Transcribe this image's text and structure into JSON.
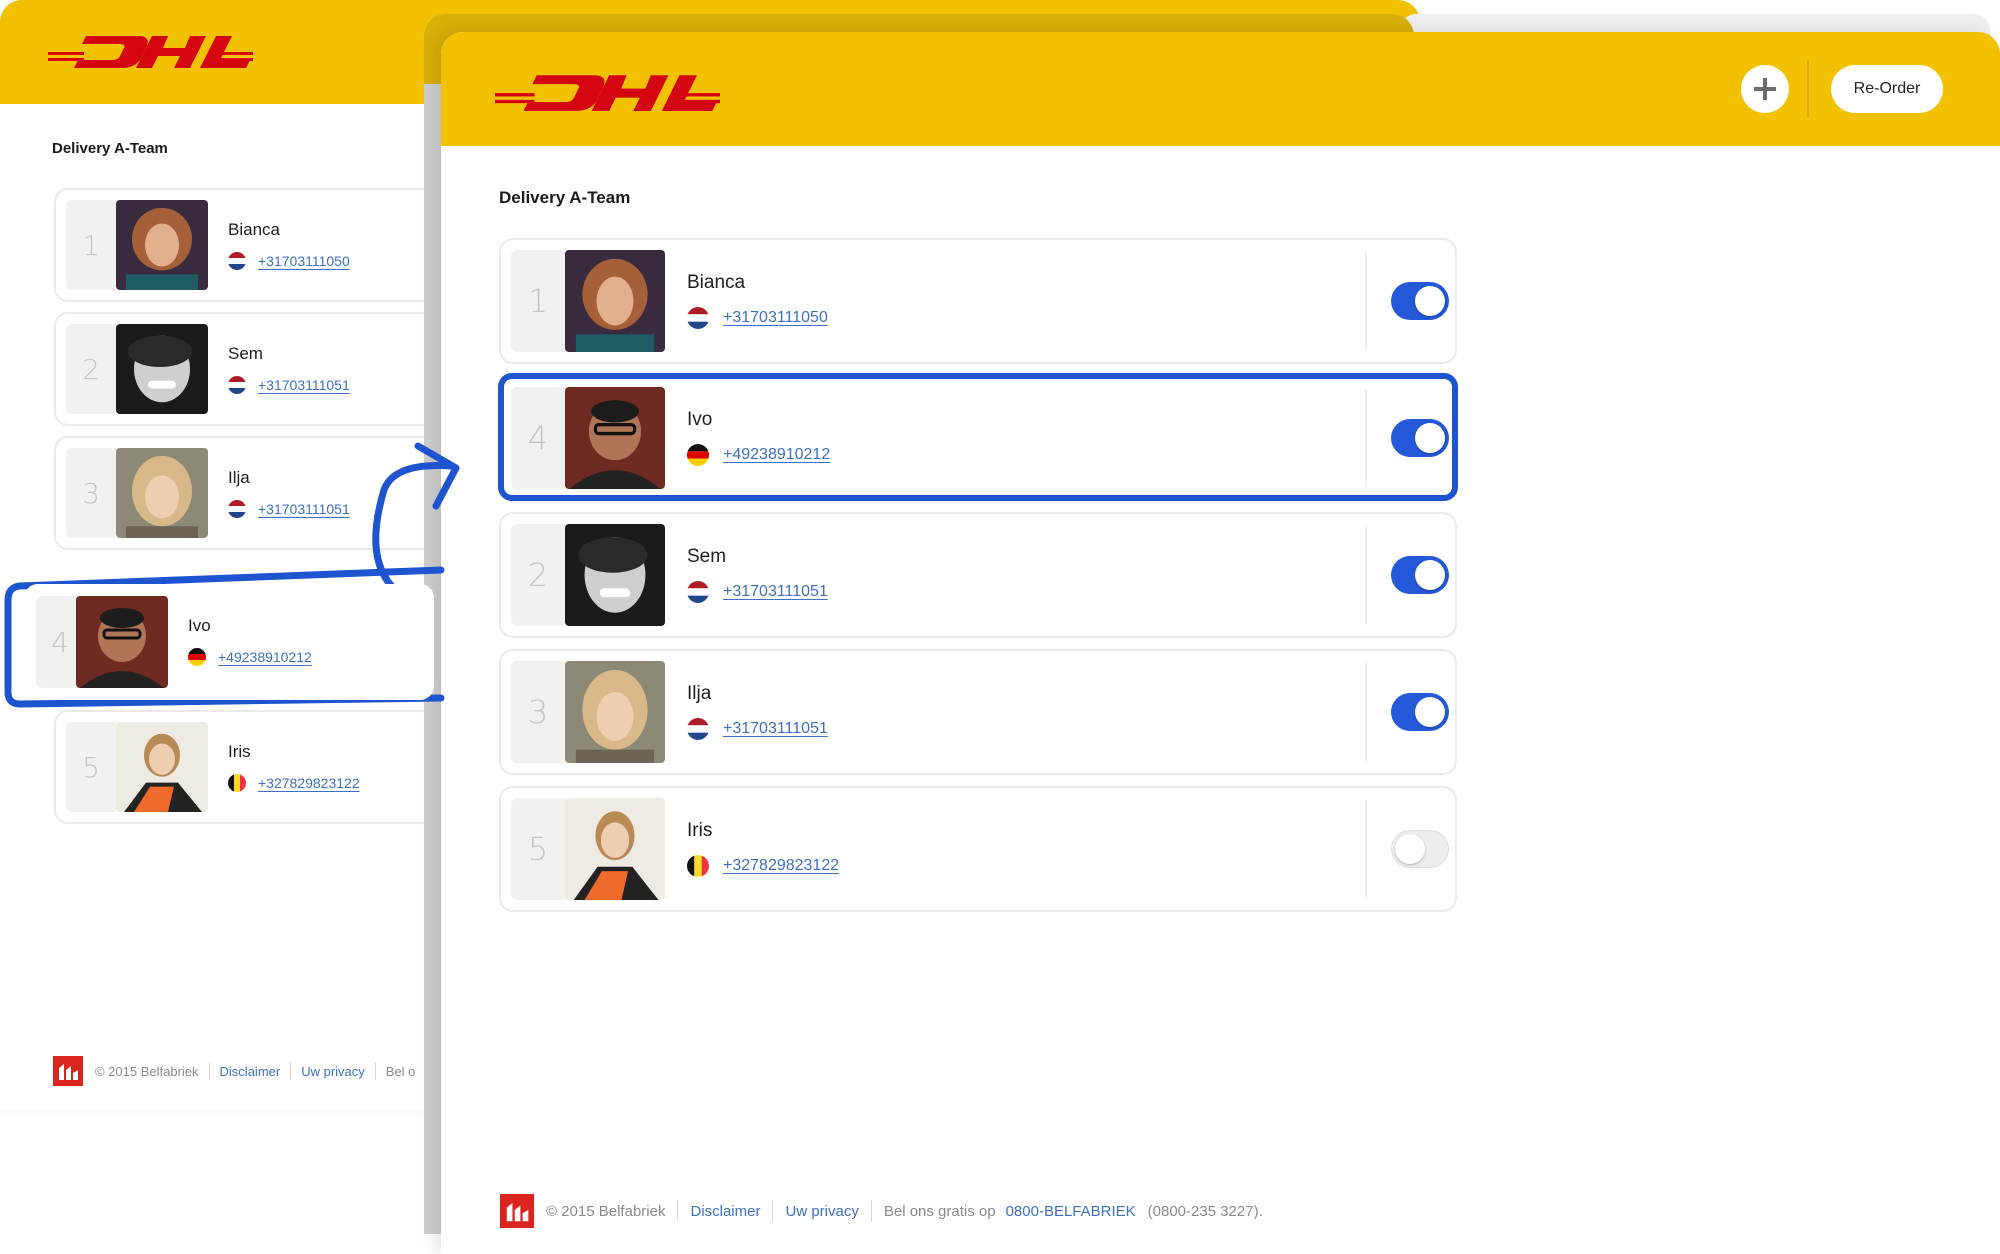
{
  "brand": {
    "logo_text": "DHL",
    "header_color": "#f2c200",
    "accent_blue": "#2458d8"
  },
  "header": {
    "add_label": "+",
    "reorder_label": "Re-Order"
  },
  "team_title": "Delivery A-Team",
  "before": {
    "contacts": [
      {
        "rank": "1",
        "name": "Bianca",
        "phone": "+31703111050",
        "flag": "nl"
      },
      {
        "rank": "2",
        "name": "Sem",
        "phone": "+31703111051",
        "flag": "nl"
      },
      {
        "rank": "3",
        "name": "Ilja",
        "phone": "+31703111051",
        "flag": "nl"
      },
      {
        "rank": "4",
        "name": "Ivo",
        "phone": "+49238910212",
        "flag": "de"
      },
      {
        "rank": "5",
        "name": "Iris",
        "phone": "+327829823122",
        "flag": "be"
      }
    ]
  },
  "after": {
    "contacts": [
      {
        "rank": "1",
        "name": "Bianca",
        "phone": "+31703111050",
        "flag": "nl",
        "enabled": true
      },
      {
        "rank": "4",
        "name": "Ivo",
        "phone": "+49238910212",
        "flag": "de",
        "enabled": true
      },
      {
        "rank": "2",
        "name": "Sem",
        "phone": "+31703111051",
        "flag": "nl",
        "enabled": true
      },
      {
        "rank": "3",
        "name": "Ilja",
        "phone": "+31703111051",
        "flag": "nl",
        "enabled": true
      },
      {
        "rank": "5",
        "name": "Iris",
        "phone": "+327829823122",
        "flag": "be",
        "enabled": false
      }
    ]
  },
  "footer": {
    "copyright": "© 2015 Belfabriek",
    "disclaimer": "Disclaimer",
    "privacy": "Uw privacy",
    "call_text": "Bel ons gratis op",
    "call_text_cut": "Bel o",
    "phone_word": "0800-BELFABRIEK",
    "phone_digits": "(0800-235 3227)."
  }
}
